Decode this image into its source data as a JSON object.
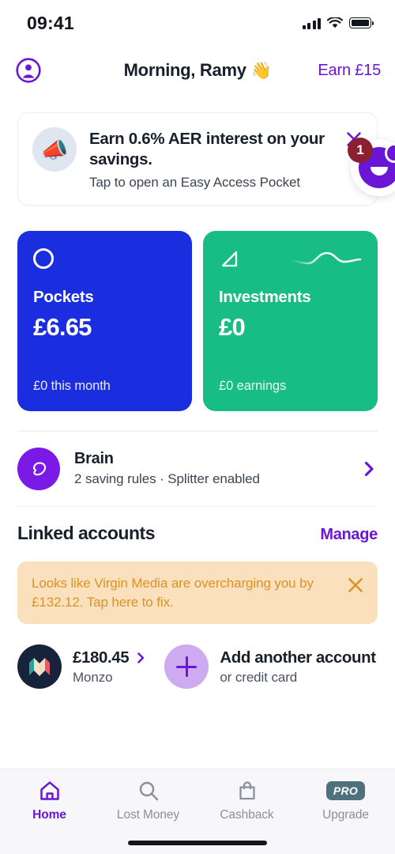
{
  "status_bar": {
    "time": "09:41",
    "signal_icon": "cellular-signal-icon",
    "wifi_icon": "wifi-icon",
    "battery_icon": "battery-icon"
  },
  "header": {
    "avatar_icon": "account-circle-icon",
    "greeting": "Morning, Ramy",
    "wave_emoji": "👋",
    "earn_label": "Earn £15"
  },
  "promo": {
    "emoji": "📣",
    "title": "Earn 0.6% AER interest on your savings.",
    "subtitle": "Tap to open an Easy Access Pocket",
    "close_icon": "close-icon"
  },
  "chat_fab": {
    "badge_count": "1",
    "icon": "chat-face-icon"
  },
  "cards": [
    {
      "name": "Pockets",
      "amount": "£6.65",
      "footnote": "£0 this month",
      "icon": "circle-outline-icon",
      "color": "#1a2ee0"
    },
    {
      "name": "Investments",
      "amount": "£0",
      "footnote": "£0 earnings",
      "icon": "triangle-chart-icon",
      "color": "#18bd85"
    }
  ],
  "brain": {
    "icon": "brain-icon",
    "title": "Brain",
    "subtitle": "2 saving rules · Splitter enabled",
    "chevron_icon": "chevron-right-icon"
  },
  "linked_accounts": {
    "title": "Linked accounts",
    "manage_label": "Manage",
    "alert": {
      "message": "Looks like Virgin Media are overcharging you by £132.12. Tap here to fix.",
      "close_icon": "close-icon",
      "color": "#d99327",
      "background": "#fbe0bd"
    },
    "accounts": [
      {
        "logo_icon": "monzo-logo-icon",
        "balance": "£180.45",
        "name": "Monzo",
        "chevron_icon": "chevron-right-icon"
      }
    ],
    "add_account": {
      "icon": "plus-icon",
      "title": "Add another account",
      "subtitle": "or credit card"
    }
  },
  "tab_bar": {
    "items": [
      {
        "label": "Home",
        "icon": "home-icon",
        "active": true
      },
      {
        "label": "Lost Money",
        "icon": "search-icon",
        "active": false
      },
      {
        "label": "Cashback",
        "icon": "bag-icon",
        "active": false
      },
      {
        "label": "Upgrade",
        "icon": "pro-badge-icon",
        "active": false,
        "badge": "PRO"
      }
    ]
  },
  "theme": {
    "accent_purple": "#6a16d6",
    "text_dark": "#18202c",
    "text_muted": "#8b8f99"
  }
}
